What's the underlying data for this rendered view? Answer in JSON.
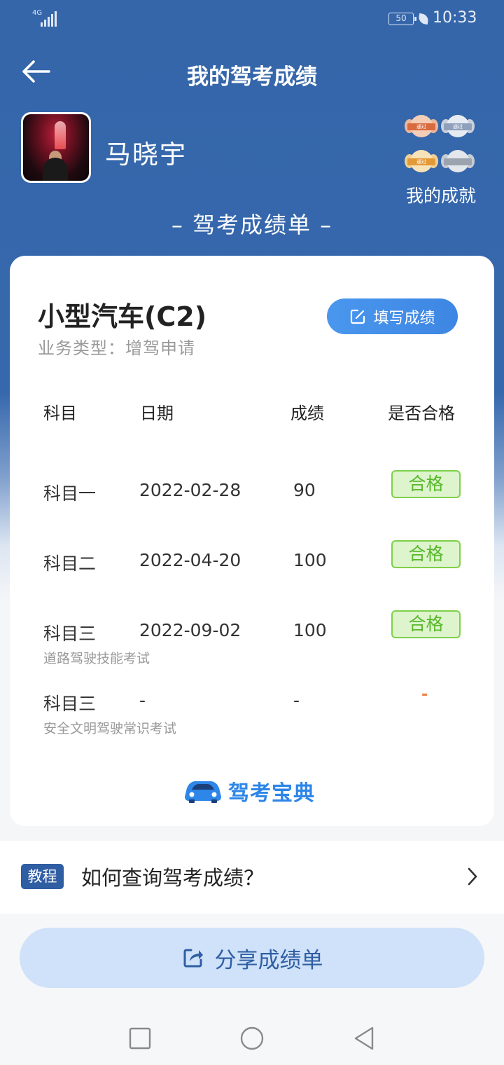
{
  "status": {
    "network": "4G",
    "battery": "50",
    "time": "10:33"
  },
  "header": {
    "title": "我的驾考成绩"
  },
  "profile": {
    "name": "马晓宇",
    "achievements_label": "我的成就",
    "medal_text": "通过"
  },
  "report": {
    "heading": "– 驾考成绩单 –",
    "vehicle_class": "小型汽车(C2)",
    "business_type": "业务类型：增驾申请",
    "fill_button": "填写成绩",
    "columns": [
      "科目",
      "日期",
      "成绩",
      "是否合格"
    ],
    "rows": [
      {
        "subject": "科目一",
        "sub": "",
        "date": "2022-02-28",
        "score": "90",
        "result": "合格"
      },
      {
        "subject": "科目二",
        "sub": "",
        "date": "2022-04-20",
        "score": "100",
        "result": "合格"
      },
      {
        "subject": "科目三",
        "sub": "道路驾驶技能考试",
        "date": "2022-09-02",
        "score": "100",
        "result": "合格"
      },
      {
        "subject": "科目三",
        "sub": "安全文明驾驶常识考试",
        "date": "-",
        "score": "-",
        "result": "-"
      }
    ],
    "brand": "驾考宝典"
  },
  "tutorial": {
    "badge": "教程",
    "text": "如何查询驾考成绩？"
  },
  "share": {
    "label": "分享成绩单"
  },
  "colors": {
    "header_blue": "#3566aa",
    "pass_green": "#58b82a",
    "accent_blue": "#3d86e3"
  }
}
